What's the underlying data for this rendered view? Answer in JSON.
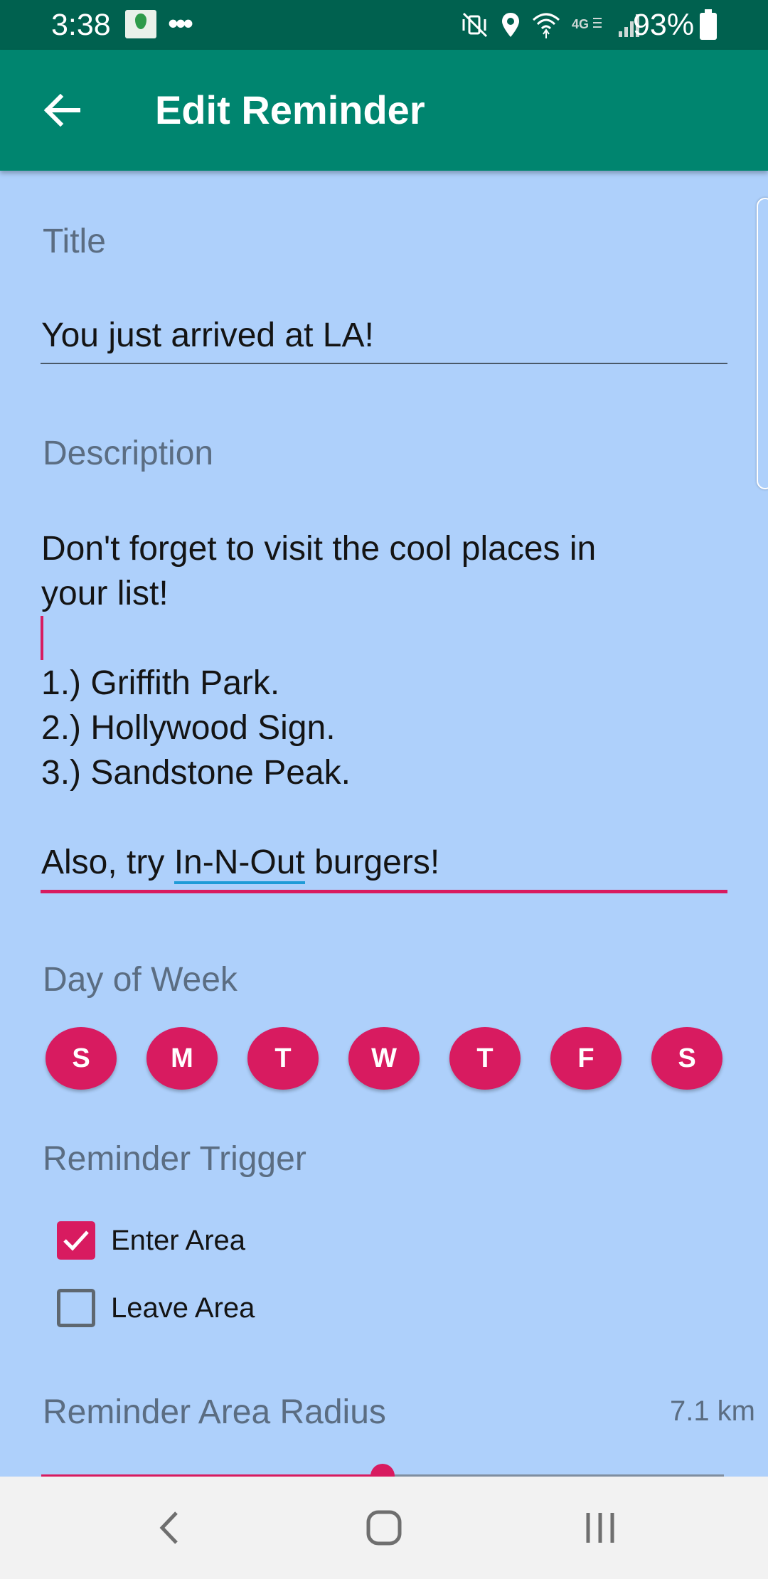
{
  "status_bar": {
    "time": "3:38",
    "more_indicator": "•••",
    "battery_percent": "93%",
    "icons": [
      "app-notification-icon",
      "mute-vibrate-icon",
      "location-icon",
      "wifi-icon",
      "lte-icon",
      "signal-icon",
      "battery-icon"
    ]
  },
  "app_bar": {
    "title": "Edit Reminder",
    "back_icon": "arrow-back-icon"
  },
  "form": {
    "title_label": "Title",
    "title_value": "You just arrived at LA!",
    "description_label": "Description",
    "description_lines": [
      "Don't forget to visit the cool places in",
      "your list!",
      "",
      "1.) Griffith Park.",
      "2.) Hollywood Sign.",
      "3.) Sandstone Peak.",
      ""
    ],
    "description_last_line": {
      "before": "Also, try ",
      "misspelled": "In-N-Out",
      "after": " burgers!"
    },
    "day_of_week_label": "Day of Week",
    "days": [
      "S",
      "M",
      "T",
      "W",
      "T",
      "F",
      "S"
    ],
    "trigger_label": "Reminder Trigger",
    "trigger_options": [
      {
        "label": "Enter Area",
        "checked": true
      },
      {
        "label": "Leave Area",
        "checked": false
      }
    ],
    "radius_label": "Reminder Area Radius",
    "radius_value": "7.1 km",
    "radius_slider_fraction": 0.5
  },
  "colors": {
    "accent": "#d81b60",
    "app_bar": "#00856f",
    "status_bar": "#00614f",
    "background": "#aed0fb"
  },
  "nav_bar": {
    "icons": [
      "back-nav-icon",
      "home-nav-icon",
      "recents-nav-icon"
    ]
  }
}
